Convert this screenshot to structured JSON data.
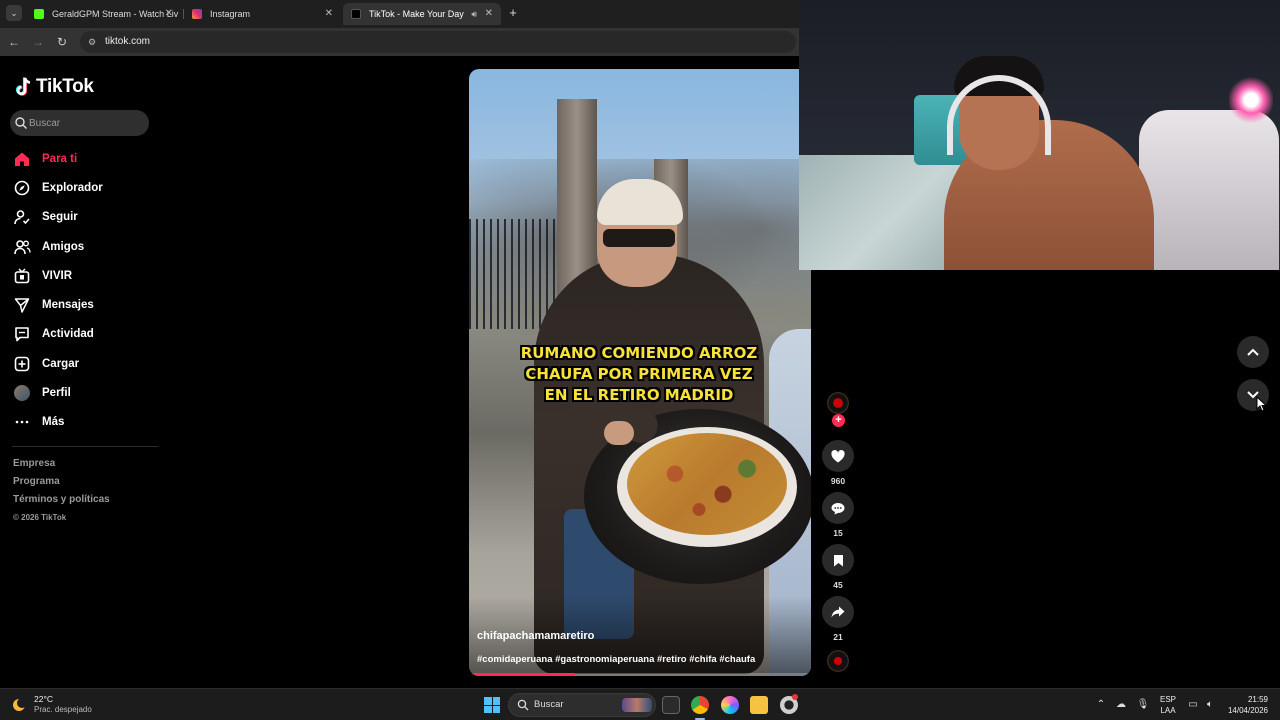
{
  "browser": {
    "tabs": [
      {
        "title": "GeraldGPM Stream - Watch Liv",
        "favicon_color": "#53fc18"
      },
      {
        "title": "Instagram",
        "favicon_color": "#e1306c"
      },
      {
        "title": "TikTok - Make Your Day",
        "favicon_color": "#000000",
        "active": true,
        "audio": true
      }
    ],
    "url": "tiktok.com"
  },
  "sidebar": {
    "logo": "TikTok",
    "search_placeholder": "Buscar",
    "nav": [
      {
        "label": "Para ti",
        "icon": "home-icon",
        "active": true
      },
      {
        "label": "Explorador",
        "icon": "compass-icon"
      },
      {
        "label": "Seguir",
        "icon": "following-icon"
      },
      {
        "label": "Amigos",
        "icon": "friends-icon"
      },
      {
        "label": "VIVIR",
        "icon": "live-icon"
      },
      {
        "label": "Mensajes",
        "icon": "messages-icon"
      },
      {
        "label": "Actividad",
        "icon": "activity-icon"
      },
      {
        "label": "Cargar",
        "icon": "upload-icon"
      },
      {
        "label": "Perfil",
        "icon": "profile-avatar"
      },
      {
        "label": "Más",
        "icon": "more-icon"
      }
    ],
    "footer": {
      "links": [
        "Empresa",
        "Programa",
        "Términos y políticas"
      ],
      "copyright": "© 2026 TikTok"
    }
  },
  "video": {
    "caption_lines": [
      "RUMANO COMIENDO ARROZ",
      "CHAUFA POR PRIMERA VEZ",
      "EN EL RETIRO MADRID"
    ],
    "author": "chifapachamamaretiro",
    "hashtags": "#comidaperuana #gastronomiaperuana #retiro #chifa #chaufa",
    "progress": 0.31
  },
  "actions": {
    "likes": "960",
    "comments": "15",
    "saves": "45",
    "shares": "21"
  },
  "taskbar": {
    "weather_temp": "22°C",
    "weather_desc": "Prac. despejado",
    "search_label": "Buscar",
    "lang_top": "ESP",
    "lang_bottom": "LAA",
    "time": "21:59",
    "date": "14/04/2026"
  },
  "colors": {
    "tiktok_red": "#fe2c55",
    "caption_yellow": "#f7e23a"
  }
}
